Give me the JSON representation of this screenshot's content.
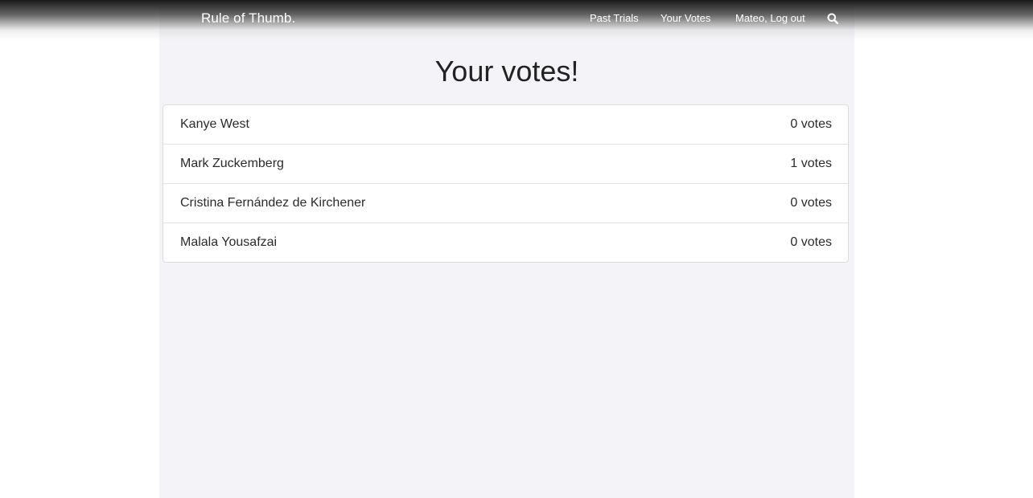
{
  "header": {
    "brand": "Rule of Thumb.",
    "nav": [
      "Past Trials",
      "Your Votes",
      "Mateo, Log out"
    ],
    "search_icon": "search-icon"
  },
  "main": {
    "title": "Your votes!",
    "items": [
      {
        "name": "Kanye West",
        "votes": "0 votes"
      },
      {
        "name": "Mark Zuckemberg",
        "votes": "1 votes"
      },
      {
        "name": "Cristina Fernández de Kirchener",
        "votes": "0 votes"
      },
      {
        "name": "Malala Yousafzai",
        "votes": "0 votes"
      }
    ]
  },
  "colors": {
    "page_background": "#ffffff",
    "content_column": "#f4f4f8",
    "header_dark": "#1a1a1a",
    "text": "#2b2b2b"
  }
}
